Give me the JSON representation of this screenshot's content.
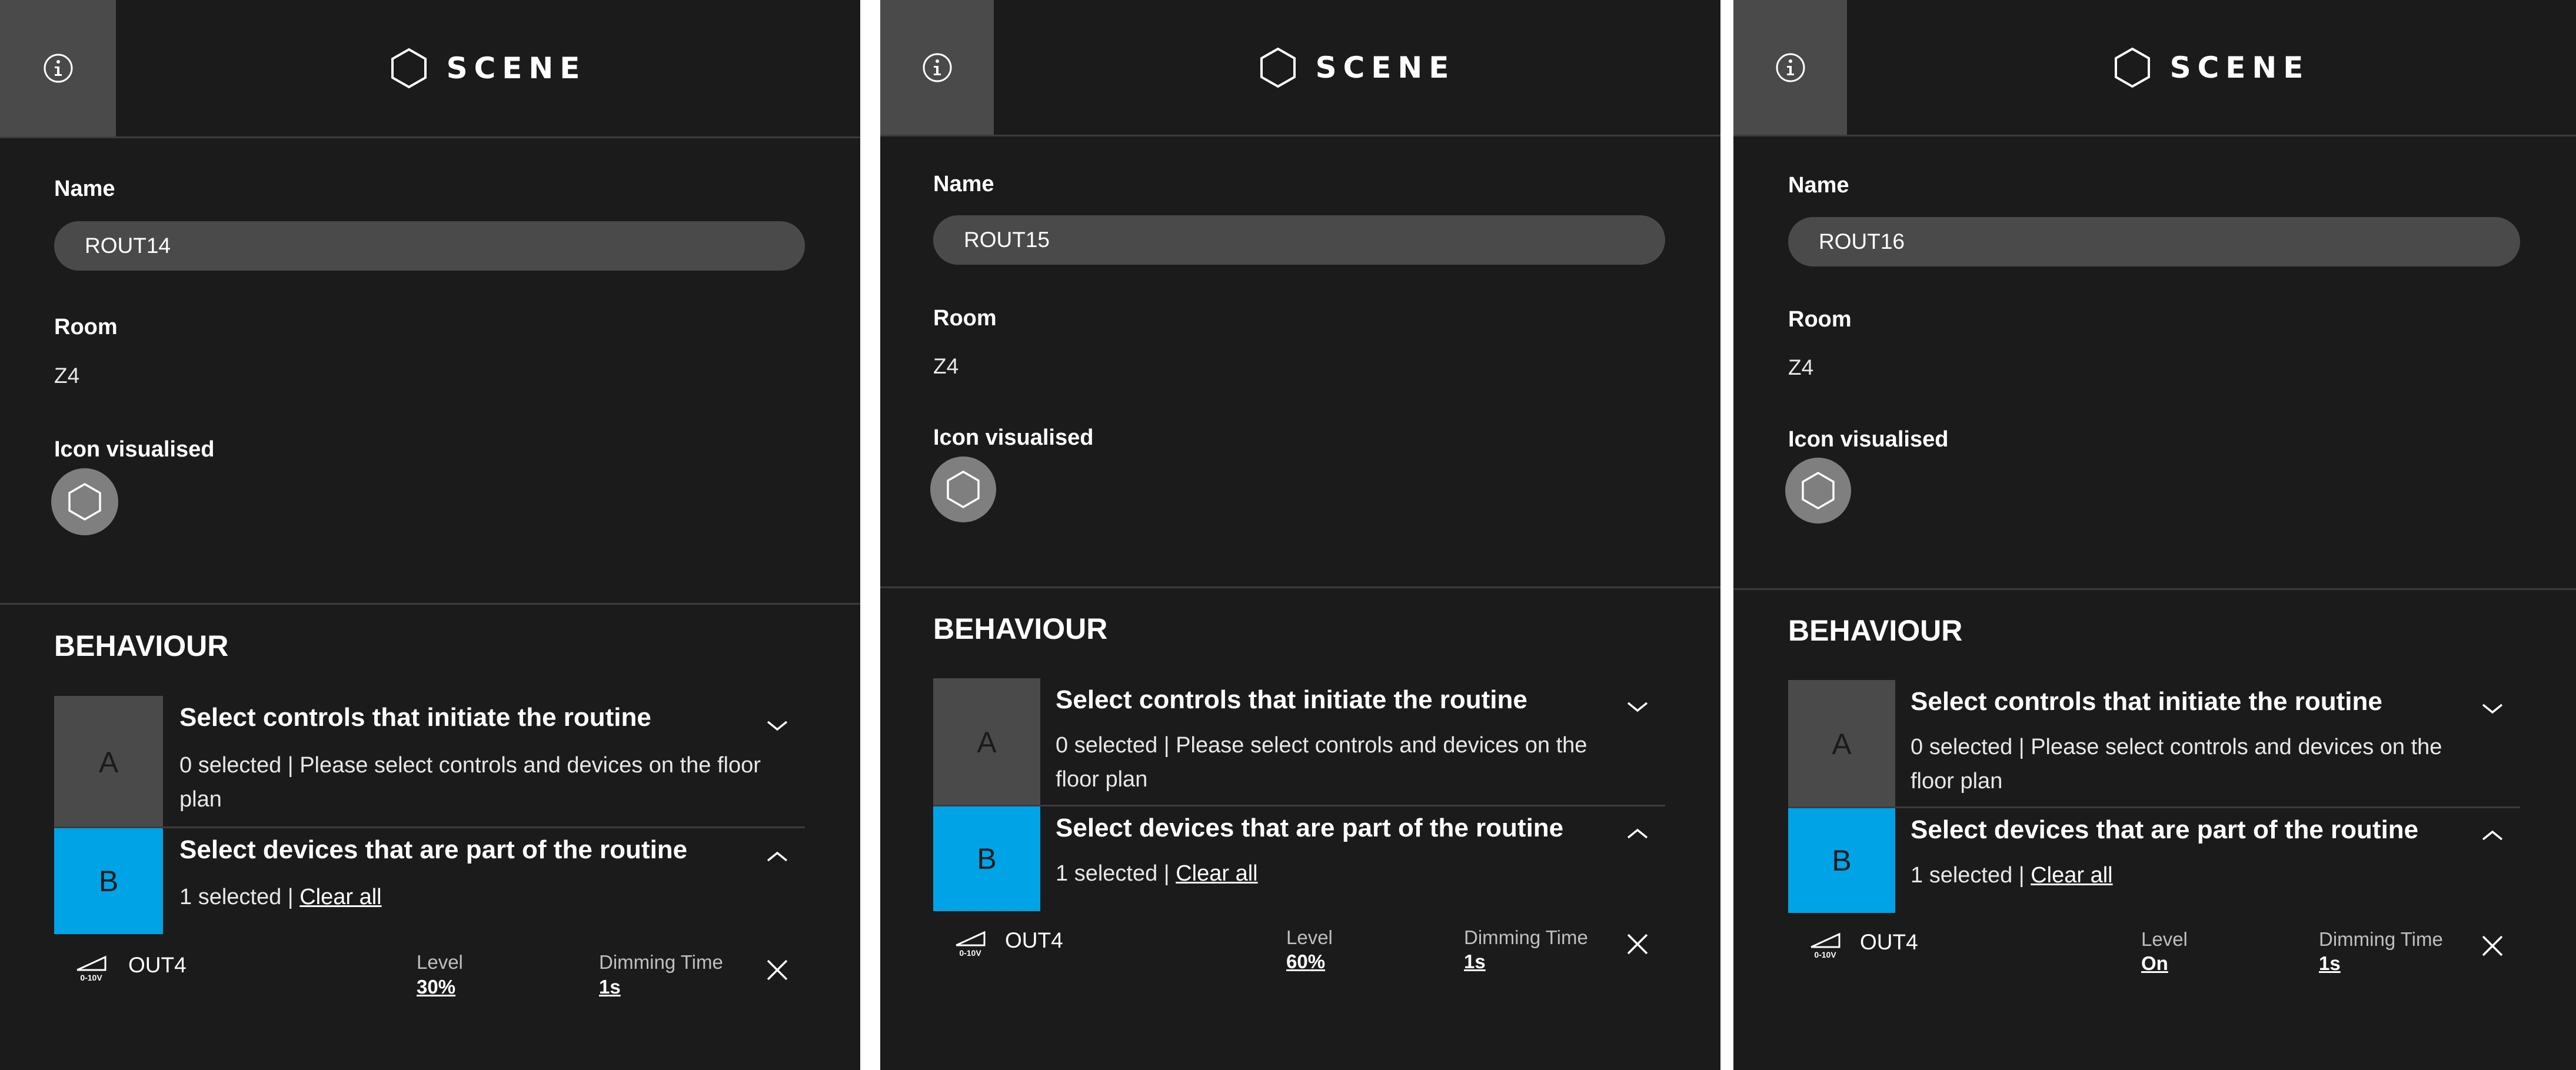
{
  "header": {
    "title": "SCENE",
    "info_icon": "info-icon",
    "title_icon": "hexagon-icon"
  },
  "labels": {
    "name": "Name",
    "room": "Room",
    "icon": "Icon visualised",
    "behaviour": "BEHAVIOUR",
    "step_a_letter": "A",
    "step_a_title": "Select controls that initiate the routine",
    "step_a_desc": "0 selected | Please select controls and devices on the floor plan",
    "step_b_letter": "B",
    "step_b_title": "Select devices that are part of the routine",
    "step_b_count": "1 selected | ",
    "clear_all": "Clear all",
    "level": "Level",
    "dimming_time": "Dimming Time"
  },
  "panels": [
    {
      "name": "ROUT14",
      "room": "Z4",
      "device": {
        "icon": "0-10V",
        "name": "OUT4",
        "level": "30%",
        "dimming_time": "1s"
      }
    },
    {
      "name": "ROUT15",
      "room": "Z4",
      "device": {
        "icon": "0-10V",
        "name": "OUT4",
        "level": "60%",
        "dimming_time": "1s"
      }
    },
    {
      "name": "ROUT16",
      "room": "Z4",
      "device": {
        "icon": "0-10V",
        "name": "OUT4",
        "level": "On",
        "dimming_time": "1s"
      }
    }
  ],
  "colors": {
    "panel_bg": "#1b1b1b",
    "header_btn_bg": "#4a4a4a",
    "field_bg": "#4a4a4a",
    "step_b_accent": "#00a3e6",
    "icon_circle_bg": "#7f7f7f",
    "divider": "#3c3c3c"
  }
}
